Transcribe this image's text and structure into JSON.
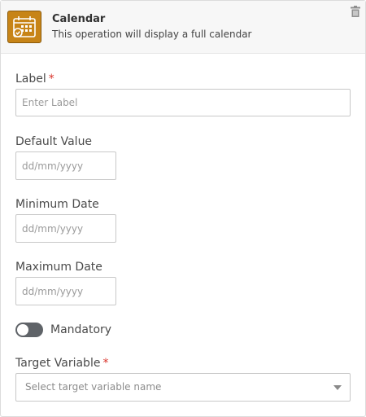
{
  "header": {
    "title": "Calendar",
    "description": "This operation will display a full calendar",
    "accent": "#c78417"
  },
  "fields": {
    "label": {
      "label": "Label",
      "required_mark": "*",
      "placeholder": "Enter Label",
      "value": ""
    },
    "default_value": {
      "label": "Default Value",
      "placeholder": "dd/mm/yyyy",
      "value": ""
    },
    "minimum_date": {
      "label": "Minimum Date",
      "placeholder": "dd/mm/yyyy",
      "value": ""
    },
    "maximum_date": {
      "label": "Maximum Date",
      "placeholder": "dd/mm/yyyy",
      "value": ""
    },
    "mandatory": {
      "label": "Mandatory",
      "checked": false
    },
    "target_variable": {
      "label": "Target Variable",
      "required_mark": "*",
      "placeholder": "Select target variable name"
    }
  },
  "icons": {
    "header": "calendar-icon",
    "delete": "trash-icon",
    "dropdown": "chevron-down-icon"
  }
}
